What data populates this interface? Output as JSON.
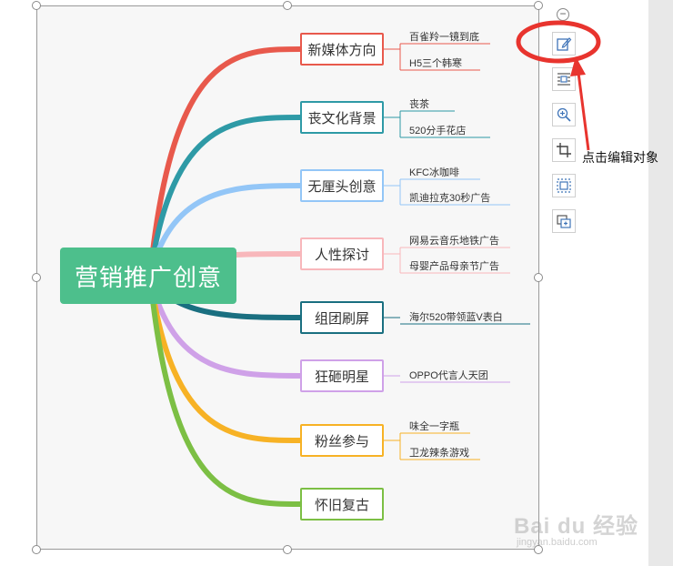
{
  "mindmap": {
    "root": "营销推广创意",
    "topics": [
      {
        "label": "新媒体方向",
        "color": "#e8594c",
        "subs": [
          "百雀羚一镜到底",
          "H5三个韩寒"
        ]
      },
      {
        "label": "丧文化背景",
        "color": "#2e9aa6",
        "subs": [
          "丧茶",
          "520分手花店"
        ]
      },
      {
        "label": "无厘头创意",
        "color": "#93c6f7",
        "subs": [
          "KFC冰咖啡",
          "凯迪拉克30秒广告"
        ]
      },
      {
        "label": "人性探讨",
        "color": "#f8b7bb",
        "subs": [
          "网易云音乐地铁广告",
          "母婴产品母亲节广告"
        ]
      },
      {
        "label": "组团刷屏",
        "color": "#1a6f80",
        "subs": [
          "海尔520带领蓝V表白"
        ]
      },
      {
        "label": "狂砸明星",
        "color": "#cfa1e8",
        "subs": [
          "OPPO代言人天团"
        ]
      },
      {
        "label": "粉丝参与",
        "color": "#f7b225",
        "subs": [
          "味全一字瓶",
          "卫龙辣条游戏"
        ]
      },
      {
        "label": "怀旧复古",
        "color": "#7cbf44",
        "subs": []
      }
    ]
  },
  "toolbar": {
    "collapse": "−",
    "buttons": [
      {
        "name": "edit-object-icon"
      },
      {
        "name": "text-wrap-icon"
      },
      {
        "name": "zoom-in-icon"
      },
      {
        "name": "crop-icon"
      },
      {
        "name": "select-area-icon"
      },
      {
        "name": "add-frame-icon"
      }
    ]
  },
  "annotation": {
    "label": "点击编辑对象",
    "color": "#e8342e"
  },
  "watermark": {
    "text": "Bai du 经验",
    "url": "jingyan.baidu.com"
  }
}
